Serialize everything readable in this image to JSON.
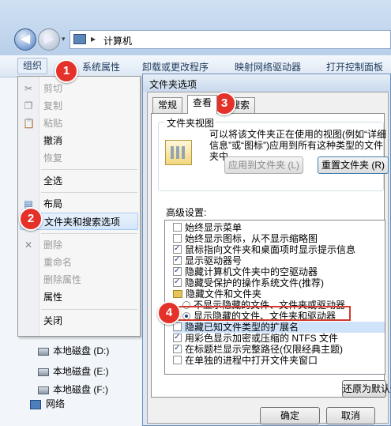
{
  "address": {
    "path": "计算机",
    "separator": "▸"
  },
  "nav": {
    "back": "◀",
    "forward": "▶",
    "dropdown": "▾"
  },
  "toolbar": {
    "organize": "组织",
    "system_properties": "系统属性",
    "uninstall": "卸载或更改程序",
    "map_drive": "映射网络驱动器",
    "control_panel": "打开控制面板"
  },
  "menu": {
    "items": [
      {
        "label": "剪切",
        "icon": "cut-icon",
        "enabled": false
      },
      {
        "label": "复制",
        "icon": "copy-icon",
        "enabled": false
      },
      {
        "label": "粘贴",
        "icon": "paste-icon",
        "enabled": false
      },
      {
        "label": "撤消",
        "enabled": true
      },
      {
        "label": "恢复",
        "enabled": false
      },
      {
        "label": "全选",
        "enabled": true
      },
      {
        "label": "布局",
        "icon": "layout-icon",
        "enabled": true
      },
      {
        "label": "文件夹和搜索选项",
        "enabled": true,
        "highlighted": true
      },
      {
        "label": "删除",
        "icon": "delete-icon",
        "enabled": false
      },
      {
        "label": "重命名",
        "enabled": false
      },
      {
        "label": "删除属性",
        "enabled": false
      },
      {
        "label": "属性",
        "enabled": true
      },
      {
        "label": "关闭",
        "enabled": true
      }
    ]
  },
  "left_pane": {
    "drives": [
      "本地磁盘 (D:)",
      "本地磁盘 (E:)",
      "本地磁盘 (F:)"
    ],
    "network": "网络"
  },
  "dialog": {
    "title": "文件夹选项",
    "tabs": [
      "常规",
      "查看",
      "搜索"
    ],
    "active_tab": "查看",
    "folder_view": {
      "legend": "文件夹视图",
      "description": "可以将该文件夹正在使用的视图(例如“详细信息”或“图标”)应用到所有这种类型的文件夹中。",
      "apply_button": "应用到文件夹 (L)",
      "reset_button": "重置文件夹 (R)"
    },
    "advanced_label": "高级设置:",
    "advanced_items": [
      {
        "type": "checkbox",
        "label": "始终显示菜单",
        "checked": false
      },
      {
        "type": "checkbox",
        "label": "始终显示图标，从不显示缩略图",
        "checked": false
      },
      {
        "type": "checkbox",
        "label": "鼠标指向文件夹和桌面项时显示提示信息",
        "checked": true
      },
      {
        "type": "checkbox",
        "label": "显示驱动器号",
        "checked": true
      },
      {
        "type": "checkbox",
        "label": "隐藏计算机文件夹中的空驱动器",
        "checked": true
      },
      {
        "type": "checkbox",
        "label": "隐藏受保护的操作系统文件(推荐)",
        "checked": true
      },
      {
        "type": "folder",
        "label": "隐藏文件和文件夹"
      },
      {
        "type": "radio",
        "label": "不显示隐藏的文件、文件夹或驱动器",
        "checked": false
      },
      {
        "type": "radio",
        "label": "显示隐藏的文件、文件夹和驱动器",
        "checked": true
      },
      {
        "type": "checkbox",
        "label": "隐藏已知文件类型的扩展名",
        "checked": false,
        "highlighted": true
      },
      {
        "type": "checkbox",
        "label": "用彩色显示加密或压缩的 NTFS 文件",
        "checked": true
      },
      {
        "type": "checkbox",
        "label": "在标题栏显示完整路径(仅限经典主题)",
        "checked": true
      },
      {
        "type": "checkbox",
        "label": "在单独的进程中打开文件夹窗口",
        "checked": false
      }
    ],
    "restore_defaults": "还原为默认值",
    "ok": "确定",
    "cancel": "取消"
  },
  "steps": [
    "1",
    "2",
    "3",
    "4"
  ],
  "colors": {
    "badge": "#e4322b",
    "highlight_box": "#d23b2c",
    "menu_highlight": "#d4e6fb"
  }
}
